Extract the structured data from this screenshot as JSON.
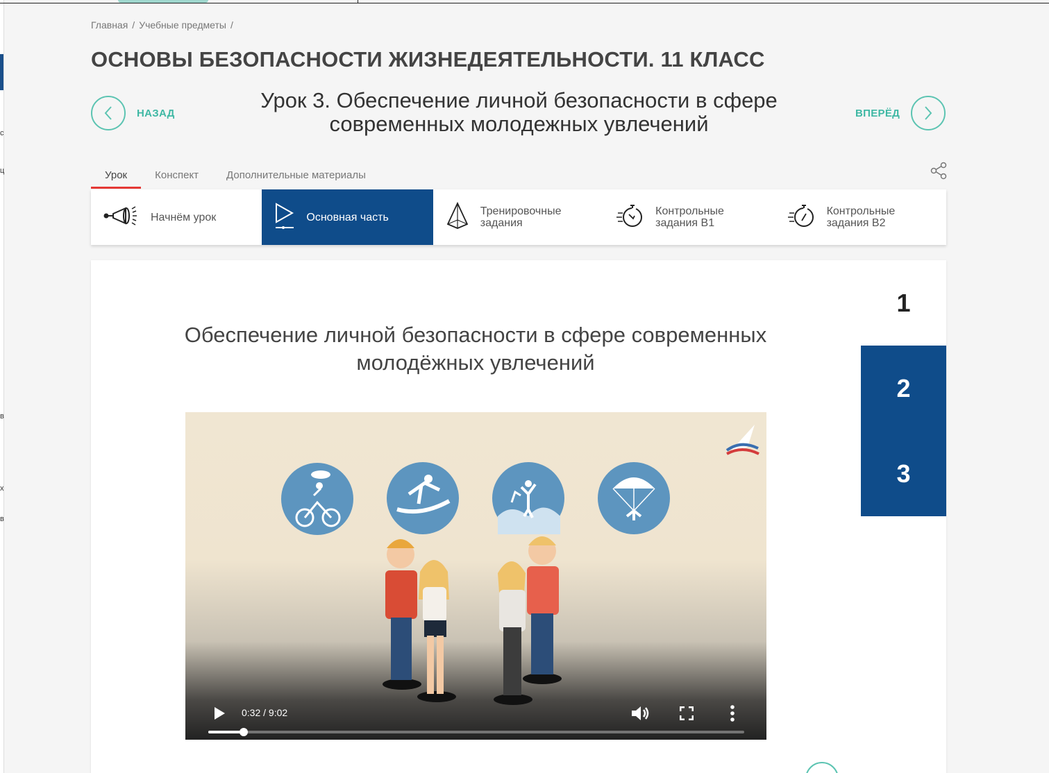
{
  "breadcrumb": {
    "home": "Главная",
    "sep1": "/",
    "subjects": "Учебные предметы",
    "sep2": "/"
  },
  "page_title": "ОСНОВЫ БЕЗОПАСНОСТИ ЖИЗНЕДЕЯТЕЛЬНОСТИ. 11 КЛАСС",
  "nav": {
    "prev_label": "НАЗАД",
    "next_label": "ВПЕРЁД"
  },
  "lesson_title_line1": "Урок 3. Обеспечение личной безопасности в сфере",
  "lesson_title_line2": "современных молодежных увлечений",
  "tabs": [
    {
      "label": "Урок",
      "active": true
    },
    {
      "label": "Конспект",
      "active": false
    },
    {
      "label": "Дополнительные материалы",
      "active": false
    }
  ],
  "steps": [
    {
      "line1": "Начнём урок",
      "line2": "",
      "icon": "megaphone-icon"
    },
    {
      "line1": "Основная часть",
      "line2": "",
      "icon": "play-icon"
    },
    {
      "line1": "Тренировочные",
      "line2": "задания",
      "icon": "pyramid-icon"
    },
    {
      "line1": "Контрольные",
      "line2": "задания В1",
      "icon": "stopwatch-icon"
    },
    {
      "line1": "Контрольные",
      "line2": "задания В2",
      "icon": "stopwatch-icon"
    }
  ],
  "active_step": 1,
  "slide_title_line1": "Обеспечение личной безопасности в сфере современных",
  "slide_title_line2": "молодёжных увлечений",
  "pager": [
    "1",
    "2",
    "3"
  ],
  "video": {
    "time": "0:32 / 9:02",
    "progress": 0.066
  },
  "colors": {
    "accent_blue": "#0f4c8a",
    "accent_teal": "#3fb8a4",
    "tab_underline": "#e53935"
  },
  "left_strip_glyphs": [
    "с",
    "ц",
    "в",
    "х",
    "в"
  ]
}
